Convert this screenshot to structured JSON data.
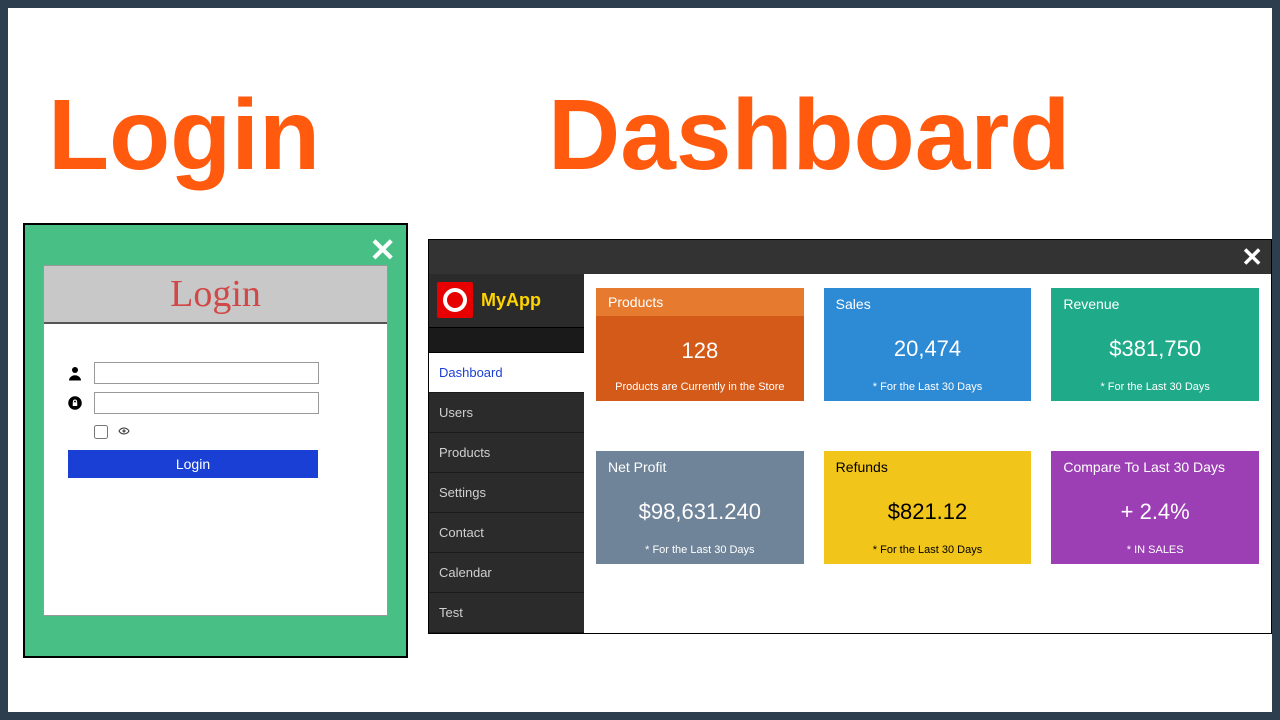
{
  "titles": {
    "login": "Login",
    "dashboard": "Dashboard"
  },
  "login": {
    "header": "Login",
    "button": "Login",
    "username_value": "",
    "password_value": ""
  },
  "app": {
    "name": "MyApp"
  },
  "sidebar": {
    "items": [
      {
        "label": "Dashboard",
        "active": true
      },
      {
        "label": "Users"
      },
      {
        "label": "Products"
      },
      {
        "label": "Settings"
      },
      {
        "label": "Contact"
      },
      {
        "label": "Calendar"
      },
      {
        "label": "Test"
      }
    ]
  },
  "cards": {
    "row1": [
      {
        "title": "Products",
        "value": "128",
        "sub": "Products are Currently in the Store",
        "cls": "c-orange"
      },
      {
        "title": "Sales",
        "value": "20,474",
        "sub": "* For the Last 30 Days",
        "cls": "c-blue"
      },
      {
        "title": "Revenue",
        "value": "$381,750",
        "sub": "* For the Last 30 Days",
        "cls": "c-teal"
      }
    ],
    "row2": [
      {
        "title": "Net Profit",
        "value": "$98,631.240",
        "sub": "* For the Last 30 Days",
        "cls": "c-slate"
      },
      {
        "title": "Refunds",
        "value": "$821.12",
        "sub": "* For the Last 30 Days",
        "cls": "c-yellow"
      },
      {
        "title": "Compare To Last 30 Days",
        "value": "+ 2.4%",
        "sub": "* IN SALES",
        "cls": "c-purple"
      }
    ]
  }
}
